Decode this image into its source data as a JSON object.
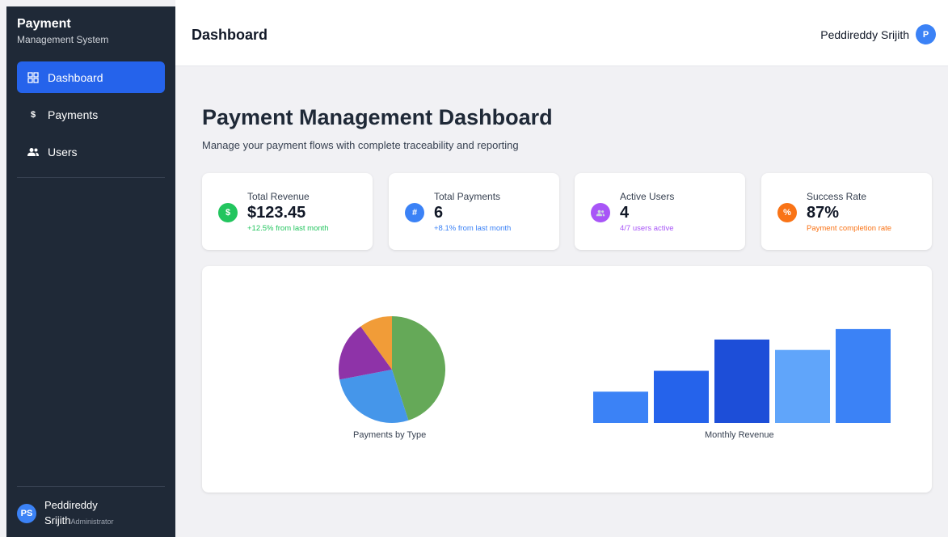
{
  "sidebar": {
    "brand_title": "Payment",
    "brand_subtitle": "Management System",
    "items": [
      {
        "label": "Dashboard",
        "icon": "grid-icon",
        "active": true
      },
      {
        "label": "Payments",
        "icon": "dollar-icon",
        "active": false
      },
      {
        "label": "Users",
        "icon": "users-icon",
        "active": false
      }
    ],
    "user": {
      "initials": "PS",
      "name_line1": "Peddireddy",
      "name_line2": "Srijith",
      "role": "Administrator"
    }
  },
  "header": {
    "title": "Dashboard",
    "user_name": "Peddireddy Srijith",
    "user_initial": "P"
  },
  "main": {
    "title": "Payment Management Dashboard",
    "subtitle": "Manage your payment flows with complete traceability and reporting"
  },
  "cards": [
    {
      "label": "Total Revenue",
      "value": "$123.45",
      "note": "+12.5% from last month",
      "icon_glyph": "$",
      "icon": "dollar-icon",
      "color": "#22c55e",
      "note_color": "#22c55e"
    },
    {
      "label": "Total Payments",
      "value": "6",
      "note": "+8.1% from last month",
      "icon_glyph": "#",
      "icon": "hash-icon",
      "color": "#3b82f6",
      "note_color": "#3b82f6"
    },
    {
      "label": "Active Users",
      "value": "4",
      "note": "4/7 users active",
      "icon_glyph": "",
      "icon": "users-icon",
      "color": "#a855f7",
      "note_color": "#a855f7"
    },
    {
      "label": "Success Rate",
      "value": "87%",
      "note": "Payment completion rate",
      "icon_glyph": "%",
      "icon": "percent-icon",
      "color": "#f97316",
      "note_color": "#f97316"
    }
  ],
  "chart_data": [
    {
      "type": "pie",
      "title": "Payments by Type",
      "slices": [
        {
          "value": 45,
          "color": "#65a958"
        },
        {
          "value": 27,
          "color": "#4596ea"
        },
        {
          "value": 18,
          "color": "#8e33a8"
        },
        {
          "value": 10,
          "color": "#f19c38"
        }
      ]
    },
    {
      "type": "bar",
      "title": "Monthly Revenue",
      "values": [
        30,
        50,
        80,
        70,
        90
      ],
      "ylim": [
        0,
        100
      ],
      "colors": [
        "#3b82f6",
        "#2563eb",
        "#1d4ed8",
        "#60a5fa",
        "#3b82f6"
      ]
    }
  ]
}
